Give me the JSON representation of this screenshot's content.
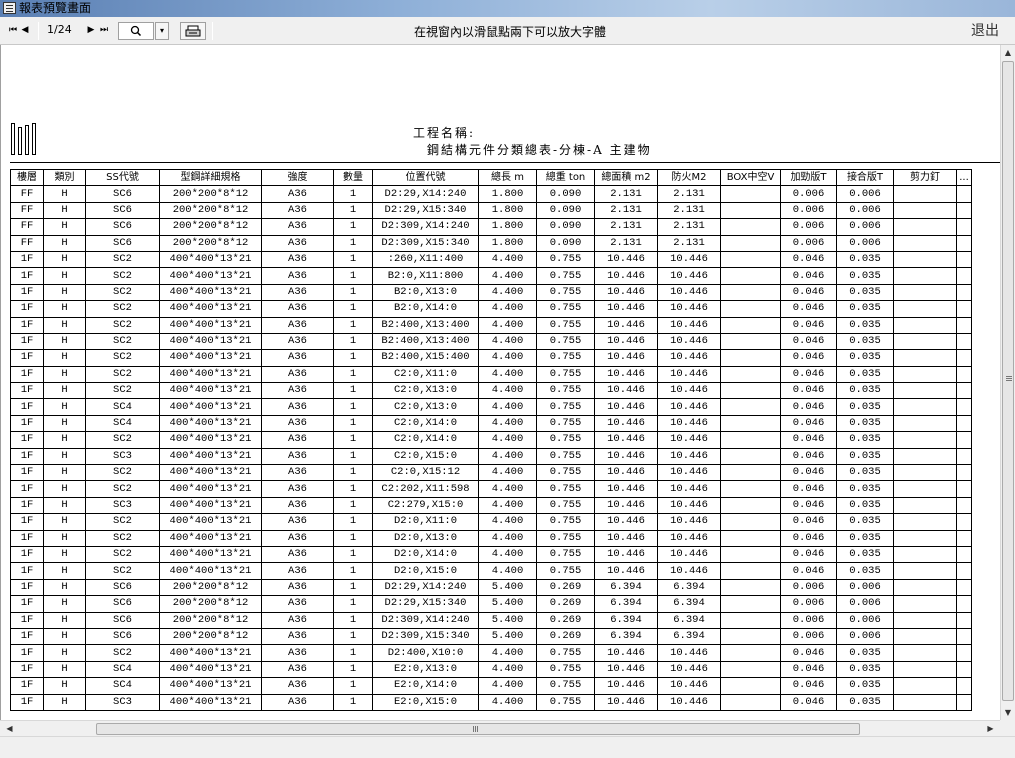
{
  "window": {
    "title": "報表預覽畫面"
  },
  "toolbar": {
    "first": "⏮",
    "prev": "◀",
    "page": "1/24",
    "next": "▶",
    "last": "⏭",
    "zoom_icon": "magnifier-icon",
    "zoom_drop": "▾",
    "print_icon": "printer-icon",
    "hint": "在視窗內以滑鼠點兩下可以放大字體",
    "exit": "退出"
  },
  "report": {
    "project_label": "工程名稱:",
    "title": "鋼結構元件分類總表-分棟-A 主建物",
    "columns": [
      "樓層",
      "類別",
      "SS代號",
      "型鋼詳細規格",
      "強度",
      "數量",
      "位置代號",
      "總長 m",
      "總重 ton",
      "總面積 m2",
      "防火M2",
      "BOX中空V",
      "加勁版T",
      "接合版T",
      "剪力釘",
      "..."
    ],
    "rows": [
      [
        "FF",
        "H",
        "SC6",
        "200*200*8*12",
        "A36",
        "1",
        "D2:29,X14:240",
        "1.800",
        "0.090",
        "2.131",
        "2.131",
        "",
        "0.006",
        "0.006",
        "",
        ""
      ],
      [
        "FF",
        "H",
        "SC6",
        "200*200*8*12",
        "A36",
        "1",
        "D2:29,X15:340",
        "1.800",
        "0.090",
        "2.131",
        "2.131",
        "",
        "0.006",
        "0.006",
        "",
        ""
      ],
      [
        "FF",
        "H",
        "SC6",
        "200*200*8*12",
        "A36",
        "1",
        "D2:309,X14:240",
        "1.800",
        "0.090",
        "2.131",
        "2.131",
        "",
        "0.006",
        "0.006",
        "",
        ""
      ],
      [
        "FF",
        "H",
        "SC6",
        "200*200*8*12",
        "A36",
        "1",
        "D2:309,X15:340",
        "1.800",
        "0.090",
        "2.131",
        "2.131",
        "",
        "0.006",
        "0.006",
        "",
        ""
      ],
      [
        "1F",
        "H",
        "SC2",
        "400*400*13*21",
        "A36",
        "1",
        ":260,X11:400",
        "4.400",
        "0.755",
        "10.446",
        "10.446",
        "",
        "0.046",
        "0.035",
        "",
        ""
      ],
      [
        "1F",
        "H",
        "SC2",
        "400*400*13*21",
        "A36",
        "1",
        "B2:0,X11:800",
        "4.400",
        "0.755",
        "10.446",
        "10.446",
        "",
        "0.046",
        "0.035",
        "",
        ""
      ],
      [
        "1F",
        "H",
        "SC2",
        "400*400*13*21",
        "A36",
        "1",
        "B2:0,X13:0",
        "4.400",
        "0.755",
        "10.446",
        "10.446",
        "",
        "0.046",
        "0.035",
        "",
        ""
      ],
      [
        "1F",
        "H",
        "SC2",
        "400*400*13*21",
        "A36",
        "1",
        "B2:0,X14:0",
        "4.400",
        "0.755",
        "10.446",
        "10.446",
        "",
        "0.046",
        "0.035",
        "",
        ""
      ],
      [
        "1F",
        "H",
        "SC2",
        "400*400*13*21",
        "A36",
        "1",
        "B2:400,X13:400",
        "4.400",
        "0.755",
        "10.446",
        "10.446",
        "",
        "0.046",
        "0.035",
        "",
        ""
      ],
      [
        "1F",
        "H",
        "SC2",
        "400*400*13*21",
        "A36",
        "1",
        "B2:400,X13:400",
        "4.400",
        "0.755",
        "10.446",
        "10.446",
        "",
        "0.046",
        "0.035",
        "",
        ""
      ],
      [
        "1F",
        "H",
        "SC2",
        "400*400*13*21",
        "A36",
        "1",
        "B2:400,X15:400",
        "4.400",
        "0.755",
        "10.446",
        "10.446",
        "",
        "0.046",
        "0.035",
        "",
        ""
      ],
      [
        "1F",
        "H",
        "SC2",
        "400*400*13*21",
        "A36",
        "1",
        "C2:0,X11:0",
        "4.400",
        "0.755",
        "10.446",
        "10.446",
        "",
        "0.046",
        "0.035",
        "",
        ""
      ],
      [
        "1F",
        "H",
        "SC2",
        "400*400*13*21",
        "A36",
        "1",
        "C2:0,X13:0",
        "4.400",
        "0.755",
        "10.446",
        "10.446",
        "",
        "0.046",
        "0.035",
        "",
        ""
      ],
      [
        "1F",
        "H",
        "SC4",
        "400*400*13*21",
        "A36",
        "1",
        "C2:0,X13:0",
        "4.400",
        "0.755",
        "10.446",
        "10.446",
        "",
        "0.046",
        "0.035",
        "",
        ""
      ],
      [
        "1F",
        "H",
        "SC4",
        "400*400*13*21",
        "A36",
        "1",
        "C2:0,X14:0",
        "4.400",
        "0.755",
        "10.446",
        "10.446",
        "",
        "0.046",
        "0.035",
        "",
        ""
      ],
      [
        "1F",
        "H",
        "SC2",
        "400*400*13*21",
        "A36",
        "1",
        "C2:0,X14:0",
        "4.400",
        "0.755",
        "10.446",
        "10.446",
        "",
        "0.046",
        "0.035",
        "",
        ""
      ],
      [
        "1F",
        "H",
        "SC3",
        "400*400*13*21",
        "A36",
        "1",
        "C2:0,X15:0",
        "4.400",
        "0.755",
        "10.446",
        "10.446",
        "",
        "0.046",
        "0.035",
        "",
        ""
      ],
      [
        "1F",
        "H",
        "SC2",
        "400*400*13*21",
        "A36",
        "1",
        "C2:0,X15:12",
        "4.400",
        "0.755",
        "10.446",
        "10.446",
        "",
        "0.046",
        "0.035",
        "",
        ""
      ],
      [
        "1F",
        "H",
        "SC2",
        "400*400*13*21",
        "A36",
        "1",
        "C2:202,X11:598",
        "4.400",
        "0.755",
        "10.446",
        "10.446",
        "",
        "0.046",
        "0.035",
        "",
        ""
      ],
      [
        "1F",
        "H",
        "SC3",
        "400*400*13*21",
        "A36",
        "1",
        "C2:279,X15:0",
        "4.400",
        "0.755",
        "10.446",
        "10.446",
        "",
        "0.046",
        "0.035",
        "",
        ""
      ],
      [
        "1F",
        "H",
        "SC2",
        "400*400*13*21",
        "A36",
        "1",
        "D2:0,X11:0",
        "4.400",
        "0.755",
        "10.446",
        "10.446",
        "",
        "0.046",
        "0.035",
        "",
        ""
      ],
      [
        "1F",
        "H",
        "SC2",
        "400*400*13*21",
        "A36",
        "1",
        "D2:0,X13:0",
        "4.400",
        "0.755",
        "10.446",
        "10.446",
        "",
        "0.046",
        "0.035",
        "",
        ""
      ],
      [
        "1F",
        "H",
        "SC2",
        "400*400*13*21",
        "A36",
        "1",
        "D2:0,X14:0",
        "4.400",
        "0.755",
        "10.446",
        "10.446",
        "",
        "0.046",
        "0.035",
        "",
        ""
      ],
      [
        "1F",
        "H",
        "SC2",
        "400*400*13*21",
        "A36",
        "1",
        "D2:0,X15:0",
        "4.400",
        "0.755",
        "10.446",
        "10.446",
        "",
        "0.046",
        "0.035",
        "",
        ""
      ],
      [
        "1F",
        "H",
        "SC6",
        "200*200*8*12",
        "A36",
        "1",
        "D2:29,X14:240",
        "5.400",
        "0.269",
        "6.394",
        "6.394",
        "",
        "0.006",
        "0.006",
        "",
        ""
      ],
      [
        "1F",
        "H",
        "SC6",
        "200*200*8*12",
        "A36",
        "1",
        "D2:29,X15:340",
        "5.400",
        "0.269",
        "6.394",
        "6.394",
        "",
        "0.006",
        "0.006",
        "",
        ""
      ],
      [
        "1F",
        "H",
        "SC6",
        "200*200*8*12",
        "A36",
        "1",
        "D2:309,X14:240",
        "5.400",
        "0.269",
        "6.394",
        "6.394",
        "",
        "0.006",
        "0.006",
        "",
        ""
      ],
      [
        "1F",
        "H",
        "SC6",
        "200*200*8*12",
        "A36",
        "1",
        "D2:309,X15:340",
        "5.400",
        "0.269",
        "6.394",
        "6.394",
        "",
        "0.006",
        "0.006",
        "",
        ""
      ],
      [
        "1F",
        "H",
        "SC2",
        "400*400*13*21",
        "A36",
        "1",
        "D2:400,X10:0",
        "4.400",
        "0.755",
        "10.446",
        "10.446",
        "",
        "0.046",
        "0.035",
        "",
        ""
      ],
      [
        "1F",
        "H",
        "SC4",
        "400*400*13*21",
        "A36",
        "1",
        "E2:0,X13:0",
        "4.400",
        "0.755",
        "10.446",
        "10.446",
        "",
        "0.046",
        "0.035",
        "",
        ""
      ],
      [
        "1F",
        "H",
        "SC4",
        "400*400*13*21",
        "A36",
        "1",
        "E2:0,X14:0",
        "4.400",
        "0.755",
        "10.446",
        "10.446",
        "",
        "0.046",
        "0.035",
        "",
        ""
      ],
      [
        "1F",
        "H",
        "SC3",
        "400*400*13*21",
        "A36",
        "1",
        "E2:0,X15:0",
        "4.400",
        "0.755",
        "10.446",
        "10.446",
        "",
        "0.046",
        "0.035",
        "",
        ""
      ]
    ]
  }
}
